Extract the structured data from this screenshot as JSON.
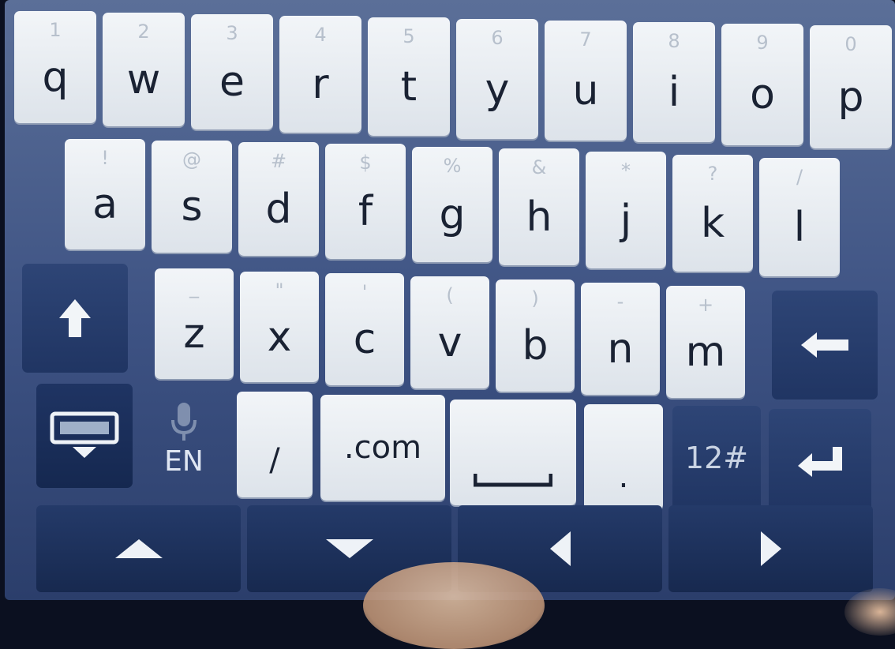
{
  "rows": [
    [
      {
        "k": "q",
        "h": "1"
      },
      {
        "k": "w",
        "h": "2"
      },
      {
        "k": "e",
        "h": "3"
      },
      {
        "k": "r",
        "h": "4"
      },
      {
        "k": "t",
        "h": "5"
      },
      {
        "k": "y",
        "h": "6"
      },
      {
        "k": "u",
        "h": "7"
      },
      {
        "k": "i",
        "h": "8"
      },
      {
        "k": "o",
        "h": "9"
      },
      {
        "k": "p",
        "h": "0"
      }
    ],
    [
      {
        "k": "a",
        "h": "!"
      },
      {
        "k": "s",
        "h": "@"
      },
      {
        "k": "d",
        "h": "#"
      },
      {
        "k": "f",
        "h": "$"
      },
      {
        "k": "g",
        "h": "%"
      },
      {
        "k": "h",
        "h": "&"
      },
      {
        "k": "j",
        "h": "*"
      },
      {
        "k": "k",
        "h": "?"
      },
      {
        "k": "l",
        "h": "/"
      }
    ],
    [
      {
        "k": "z",
        "h": "_"
      },
      {
        "k": "x",
        "h": "\""
      },
      {
        "k": "c",
        "h": "'"
      },
      {
        "k": "v",
        "h": "("
      },
      {
        "k": "b",
        "h": ")"
      },
      {
        "k": "n",
        "h": "-"
      },
      {
        "k": "m",
        "h": "+"
      }
    ]
  ],
  "bottom": {
    "lang": "EN",
    "slash": "/",
    "dotcom": ".com",
    "period": ".",
    "symbols": "12#"
  },
  "icons": {
    "shift": "shift-arrow-icon",
    "backspace": "backspace-icon",
    "hide_keyboard": "hide-keyboard-icon",
    "mic": "microphone-icon",
    "enter": "enter-icon",
    "space": "space-bar-icon",
    "nav_up": "arrow-up-icon",
    "nav_down": "arrow-down-icon",
    "nav_left": "arrow-left-icon",
    "nav_right": "arrow-right-icon"
  },
  "colors": {
    "key_light": "#e8edf2",
    "key_dark": "#263c6c",
    "background": "#3d5283"
  }
}
